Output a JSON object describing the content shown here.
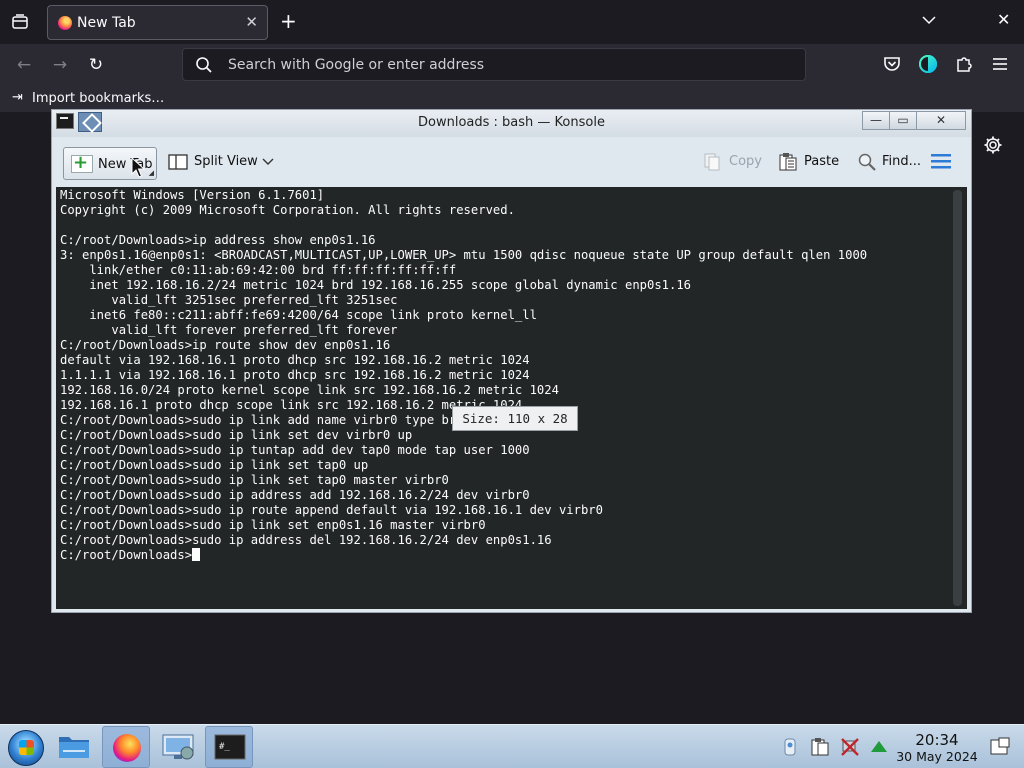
{
  "browser": {
    "tab": {
      "title": "New Tab",
      "close_glyph": "✕"
    },
    "new_tab_glyph": "+",
    "window_close_glyph": "✕",
    "nav": {
      "back_glyph": "←",
      "forward_glyph": "→",
      "reload_glyph": "↻"
    },
    "urlbar": {
      "placeholder": "Search with Google or enter address"
    },
    "bookmarks": {
      "import_label": "Import bookmarks…",
      "import_glyph": "⇥"
    }
  },
  "konsole": {
    "title": "Downloads : bash — Konsole",
    "window_buttons": {
      "minimize": "—",
      "maximize": "▭",
      "close": "✕"
    },
    "toolbar": {
      "new_tab": "New Tab",
      "split_view": "Split View",
      "copy": "Copy",
      "paste": "Paste",
      "find": "Find..."
    },
    "terminal_lines": [
      "Microsoft Windows [Version 6.1.7601]",
      "Copyright (c) 2009 Microsoft Corporation. All rights reserved.",
      "",
      "C:/root/Downloads>ip address show enp0s1.16",
      "3: enp0s1.16@enp0s1: <BROADCAST,MULTICAST,UP,LOWER_UP> mtu 1500 qdisc noqueue state UP group default qlen 1000",
      "    link/ether c0:11:ab:69:42:00 brd ff:ff:ff:ff:ff:ff",
      "    inet 192.168.16.2/24 metric 1024 brd 192.168.16.255 scope global dynamic enp0s1.16",
      "       valid_lft 3251sec preferred_lft 3251sec",
      "    inet6 fe80::c211:abff:fe69:4200/64 scope link proto kernel_ll",
      "       valid_lft forever preferred_lft forever",
      "C:/root/Downloads>ip route show dev enp0s1.16",
      "default via 192.168.16.1 proto dhcp src 192.168.16.2 metric 1024",
      "1.1.1.1 via 192.168.16.1 proto dhcp src 192.168.16.2 metric 1024",
      "192.168.16.0/24 proto kernel scope link src 192.168.16.2 metric 1024",
      "192.168.16.1 proto dhcp scope link src 192.168.16.2 metric 1024",
      "C:/root/Downloads>sudo ip link add name virbr0 type bridge",
      "C:/root/Downloads>sudo ip link set dev virbr0 up",
      "C:/root/Downloads>sudo ip tuntap add dev tap0 mode tap user 1000",
      "C:/root/Downloads>sudo ip link set tap0 up",
      "C:/root/Downloads>sudo ip link set tap0 master virbr0",
      "C:/root/Downloads>sudo ip address add 192.168.16.2/24 dev virbr0",
      "C:/root/Downloads>sudo ip route append default via 192.168.16.1 dev virbr0",
      "C:/root/Downloads>sudo ip link set enp0s1.16 master virbr0",
      "C:/root/Downloads>sudo ip address del 192.168.16.2/24 dev enp0s1.16"
    ],
    "prompt": "C:/root/Downloads>",
    "size_tooltip": "Size: 110 x 28"
  },
  "taskbar": {
    "apps": [
      "start-menu",
      "file-manager",
      "firefox",
      "system-settings",
      "konsole"
    ],
    "clock": {
      "time": "20:34",
      "date": "30 May 2024"
    }
  },
  "colors": {
    "terminal_bg": "#232627",
    "terminal_fg": "#fcfcfc",
    "firefox_dark": "#1c1b22",
    "accent_blue": "#2c7bd6"
  }
}
